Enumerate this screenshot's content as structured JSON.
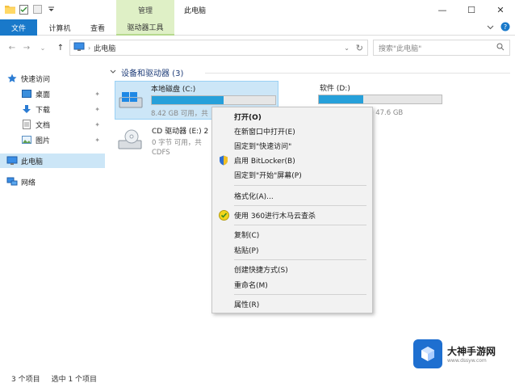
{
  "titlebar": {
    "context_tab": "管理",
    "window_title": "此电脑",
    "minimize": "—",
    "maximize": "☐",
    "close": "✕"
  },
  "ribbon": {
    "tabs": [
      {
        "label": "文件"
      },
      {
        "label": "计算机"
      },
      {
        "label": "查看"
      },
      {
        "label": "驱动器工具"
      }
    ],
    "help": "?"
  },
  "address": {
    "path": "此电脑",
    "search_placeholder": "搜索\"此电脑\""
  },
  "navpane": {
    "items": [
      {
        "label": "快速访问",
        "icon": "star-icon"
      },
      {
        "label": "桌面",
        "icon": "desktop-icon"
      },
      {
        "label": "下载",
        "icon": "download-icon"
      },
      {
        "label": "文档",
        "icon": "document-icon"
      },
      {
        "label": "图片",
        "icon": "picture-icon"
      },
      {
        "label": "此电脑",
        "icon": "computer-icon"
      },
      {
        "label": "网络",
        "icon": "network-icon"
      }
    ]
  },
  "content": {
    "group_header": "设备和驱动器 (3)",
    "drives": [
      {
        "name": "本地磁盘 (C:)",
        "free_text": "8.42 GB 可用，共",
        "used_fraction": 0.58
      },
      {
        "name": "软件 (D:)",
        "free_text": "共 47.6 GB",
        "used_fraction": 0.36
      },
      {
        "name": "CD 驱动器 (E:) 2",
        "free_text": "0 字节 可用，共",
        "fs": "CDFS"
      }
    ]
  },
  "context_menu": {
    "items": [
      {
        "label": "打开(O)"
      },
      {
        "label": "在新窗口中打开(E)"
      },
      {
        "label": "固定到\"快速访问\""
      },
      {
        "label": "启用 BitLocker(B)"
      },
      {
        "label": "固定到\"开始\"屏幕(P)"
      },
      {
        "label": "格式化(A)..."
      },
      {
        "label": "使用 360进行木马云查杀"
      },
      {
        "label": "复制(C)"
      },
      {
        "label": "粘贴(P)"
      },
      {
        "label": "创建快捷方式(S)"
      },
      {
        "label": "重命名(M)"
      },
      {
        "label": "属性(R)"
      }
    ]
  },
  "status": {
    "count": "3 个项目",
    "selected": "选中 1 个项目"
  },
  "watermark": {
    "main": "大神手游网",
    "sub": "www.dssyw.com"
  }
}
